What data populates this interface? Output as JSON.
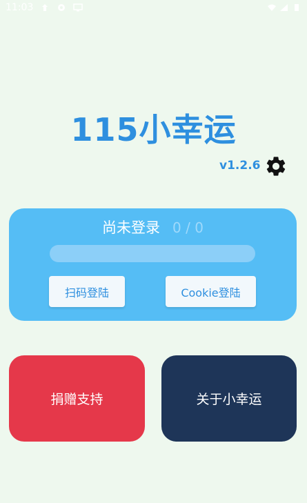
{
  "status_bar": {
    "time": "11:03",
    "icons": [
      "notification-icon",
      "settings-icon",
      "screen-icon",
      "wifi-icon",
      "signal-icon",
      "battery-icon"
    ]
  },
  "app": {
    "title": "115小幸运",
    "version": "v1.2.6",
    "accent_color": "#2e8fdf"
  },
  "login_card": {
    "status_text": "尚未登录",
    "count_text": "0 / 0",
    "progress": 0,
    "scan_login_label": "扫码登陆",
    "cookie_login_label": "Cookie登陆"
  },
  "actions": {
    "donate_label": "捐赠支持",
    "about_label": "关于小幸运"
  }
}
